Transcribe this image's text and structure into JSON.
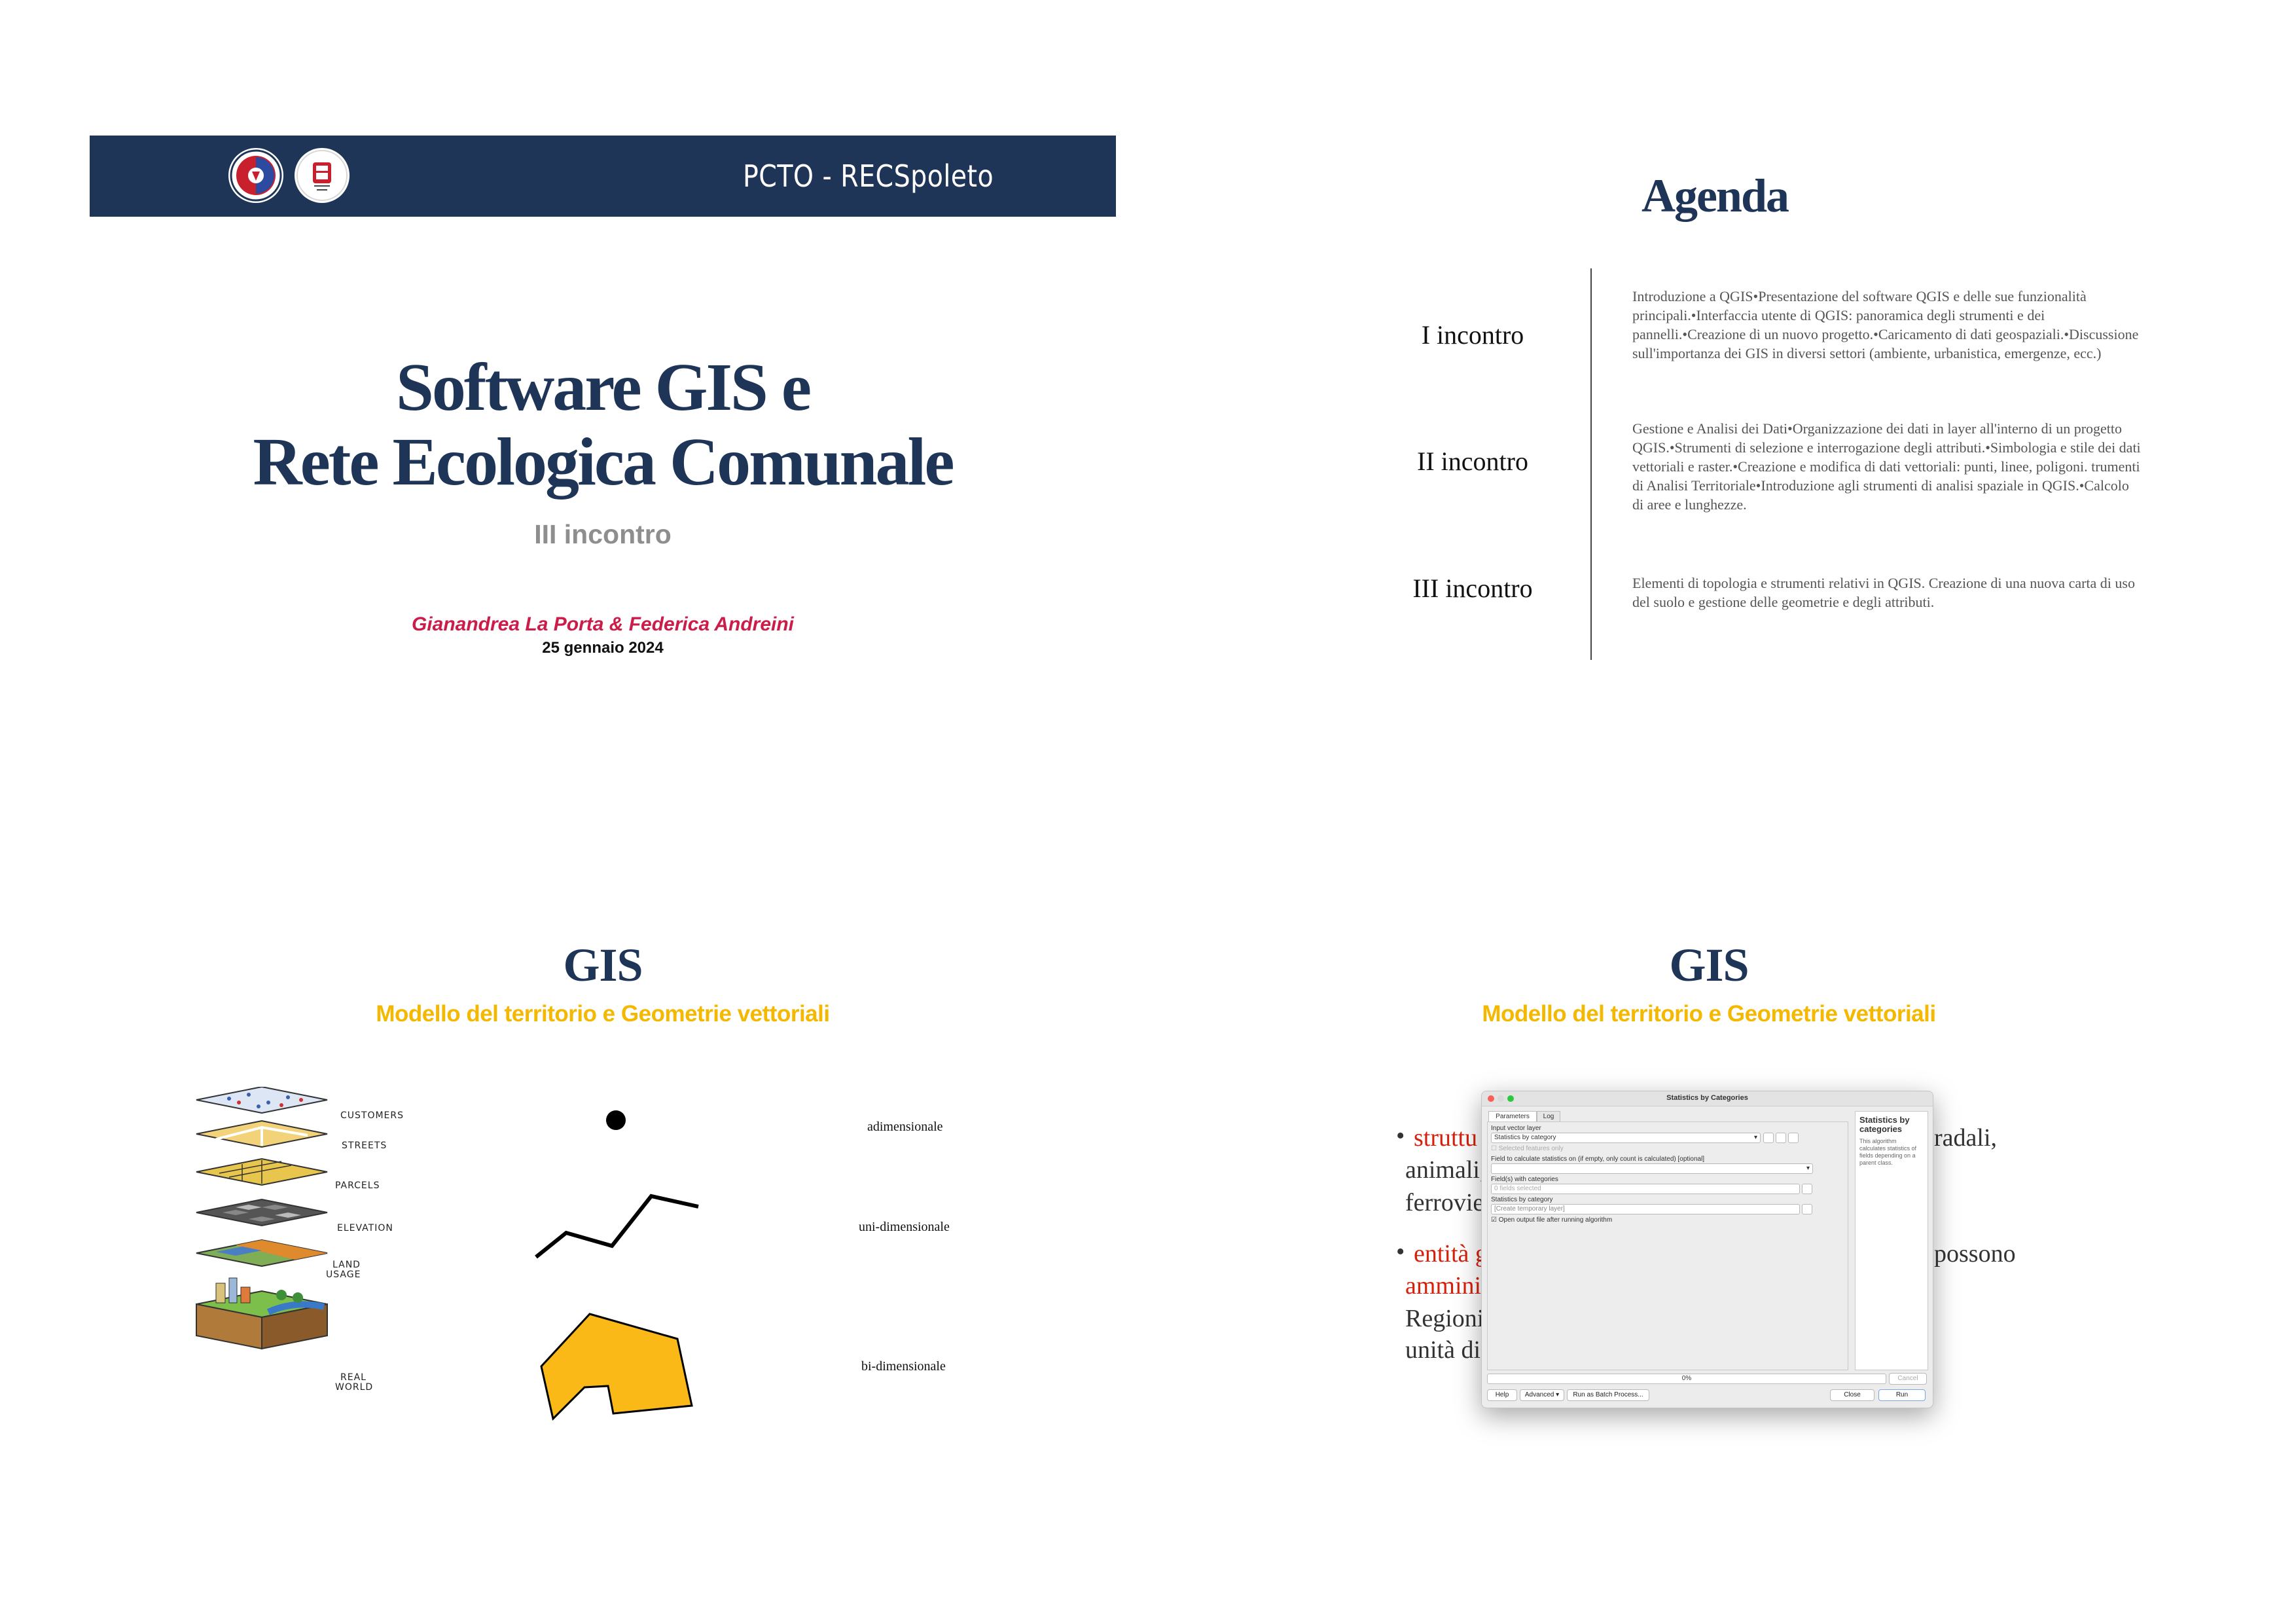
{
  "slide1": {
    "banner_title": "PCTO - RECSpoleto",
    "title_line1": "Software GIS e",
    "title_line2": "Rete Ecologica Comunale",
    "subtitle": "III incontro",
    "authors": "Gianandrea La Porta  & Federica Andreini",
    "date": "25 gennaio 2024",
    "colors": {
      "navy": "#1f3557",
      "accent_red": "#cc1d4a",
      "gray": "#8e8e8e"
    }
  },
  "slide2": {
    "title": "Agenda",
    "items": [
      {
        "label": "I incontro",
        "text": "Introduzione a QGIS•Presentazione del software QGIS e delle sue funzionalità principali.•Interfaccia utente di QGIS: panoramica degli strumenti e dei pannelli.•Creazione di un nuovo progetto.•Caricamento di dati geospaziali.•Discussione sull'importanza dei GIS in diversi settori (ambiente, urbanistica, emergenze, ecc.)"
      },
      {
        "label": "II incontro",
        "text": "Gestione e Analisi dei Dati•Organizzazione dei dati in layer all'interno di un progetto QGIS.•Strumenti di selezione e interrogazione degli attributi.•Simbologia e stile dei dati vettoriali e raster.•Creazione e modifica di dati vettoriali: punti, linee, poligoni. trumenti di Analisi Territoriale•Introduzione agli strumenti di analisi spaziale in QGIS.•Calcolo di aree e lunghezze."
      },
      {
        "label": "III incontro",
        "text": "Elementi di topologia e strumenti relativi in QGIS. Creazione di una nuova carta di uso del suolo e gestione delle geometrie e degli attributi."
      }
    ]
  },
  "slide3": {
    "title": "GIS",
    "subtitle": "Modello del territorio e Geometrie vettoriali",
    "layers": [
      "CUSTOMERS",
      "STREETS",
      "PARCELS",
      "ELEVATION",
      "LAND",
      "USAGE",
      "REAL",
      "WORLD"
    ],
    "geometries": [
      {
        "label": "adimensionale",
        "icon": "point-icon"
      },
      {
        "label": "uni-dimensionale",
        "icon": "line-icon"
      },
      {
        "label": "bi-dimensionale",
        "icon": "polygon-icon"
      }
    ],
    "colors": {
      "accent_yellow": "#f5b800",
      "polygon_fill": "#fbb918"
    }
  },
  "slide4": {
    "title": "GIS",
    "subtitle": "Modello del territorio e Geometrie vettoriali",
    "bullet1": {
      "red": "struttu",
      "line1_end": "radali,",
      "line2": "animali,",
      "line3": "ferrovie"
    },
    "bullet2": {
      "red": "entità g",
      "line1_end": "possono",
      "line2_red": "amminis",
      "line3": "Regioni",
      "line4": "unità di"
    },
    "dialog": {
      "window_title": "Statistics by Categories",
      "tabs": [
        "Parameters",
        "Log"
      ],
      "input_layer_label": "Input vector layer",
      "input_layer_value": "Statistics by category",
      "selected_only_label": "Selected features only",
      "field_label": "Field to calculate statistics on (if empty, only count is calculated) [optional]",
      "categories_label": "Field(s) with categories",
      "categories_value": "0 fields selected",
      "output_label": "Statistics by category",
      "output_value": "[Create temporary layer]",
      "open_output_label": "Open output file after running algorithm",
      "help_title": "Statistics by categories",
      "help_text": "This algorithm calculates statistics of fields depending on a parent class.",
      "progress": "0%",
      "cancel": "Cancel",
      "buttons": {
        "help": "Help",
        "advanced": "Advanced",
        "batch": "Run as Batch Process...",
        "close": "Close",
        "run": "Run"
      }
    }
  }
}
